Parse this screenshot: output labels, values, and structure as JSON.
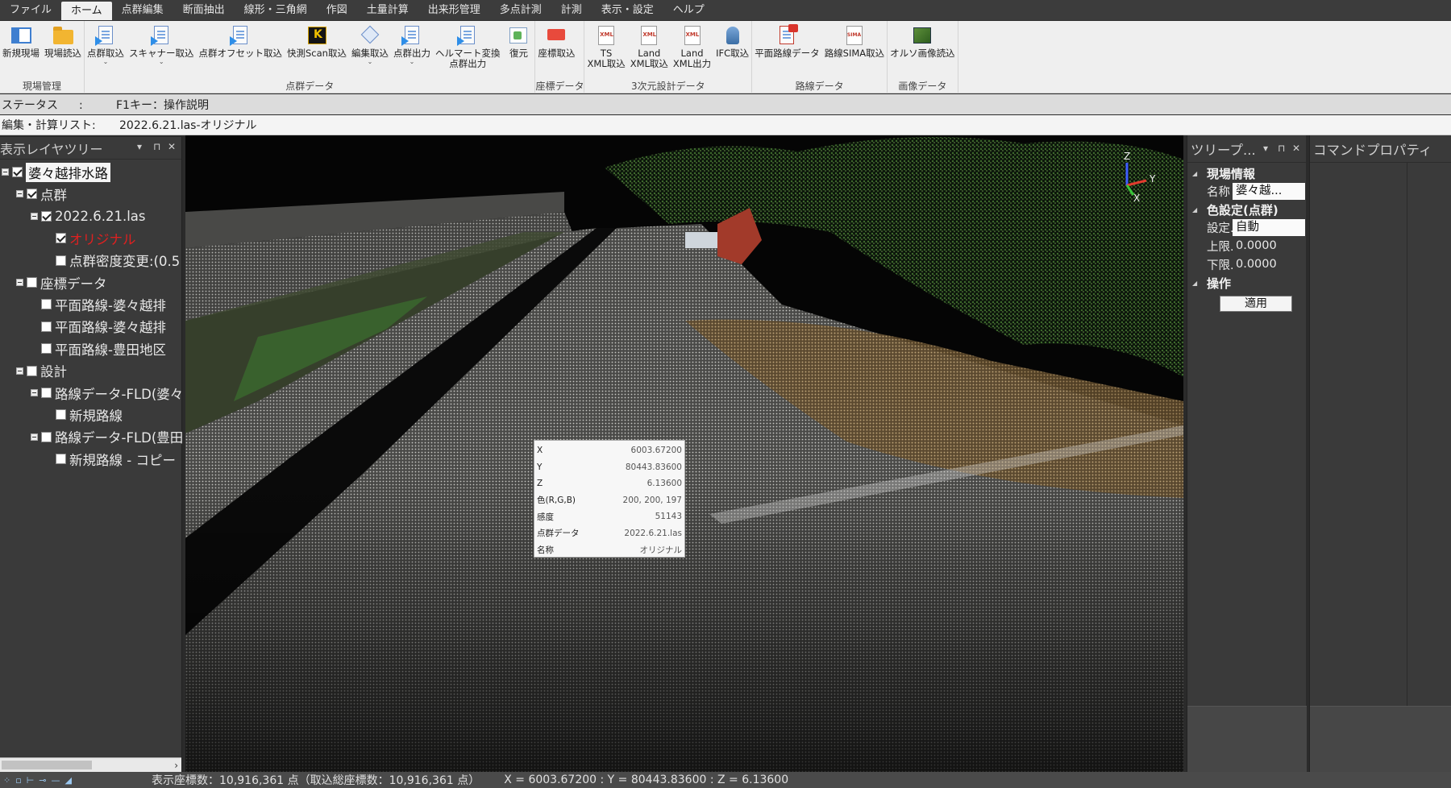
{
  "menu": [
    "ファイル",
    "ホーム",
    "点群編集",
    "断面抽出",
    "線形・三角網",
    "作図",
    "土量計算",
    "出来形管理",
    "多点計測",
    "計測",
    "表示・設定",
    "ヘルプ"
  ],
  "menu_active_index": 1,
  "ribbon": {
    "groups": [
      {
        "label": "現場管理",
        "buttons": [
          {
            "label": "新規現場",
            "icon": "new-site-icon"
          },
          {
            "label": "現場読込",
            "icon": "folder-open-icon"
          }
        ]
      },
      {
        "label": "点群データ",
        "buttons": [
          {
            "label": "点群取込",
            "icon": "pointcloud-import-icon"
          },
          {
            "label": "スキャナー取込",
            "icon": "scanner-import-icon"
          },
          {
            "label": "点群オフセット取込",
            "icon": "offset-import-icon"
          },
          {
            "label": "快測Scan取込",
            "icon": "kaisoku-scan-icon"
          },
          {
            "label": "編集取込",
            "icon": "edit-import-icon"
          },
          {
            "label": "点群出力",
            "icon": "pointcloud-export-icon"
          },
          {
            "label": "ヘルマート変換\n点群出力",
            "icon": "helmert-export-icon"
          },
          {
            "label": "復元",
            "icon": "restore-icon"
          }
        ]
      },
      {
        "label": "座標データ",
        "buttons": [
          {
            "label": "座標取込",
            "icon": "coord-import-icon"
          }
        ]
      },
      {
        "label": "3次元設計データ",
        "buttons": [
          {
            "label": "TS\nXML取込",
            "icon": "ts-xml-icon"
          },
          {
            "label": "Land\nXML取込",
            "icon": "landxml-import-icon"
          },
          {
            "label": "Land\nXML出力",
            "icon": "landxml-export-icon"
          },
          {
            "label": "IFC取込",
            "icon": "ifc-import-icon"
          }
        ]
      },
      {
        "label": "路線データ",
        "buttons": [
          {
            "label": "平面路線データ",
            "icon": "plane-route-icon"
          },
          {
            "label": "路線SIMA取込",
            "icon": "route-sima-icon"
          }
        ]
      },
      {
        "label": "画像データ",
        "buttons": [
          {
            "label": "オルソ画像読込",
            "icon": "ortho-image-icon"
          }
        ]
      }
    ]
  },
  "status": {
    "label": "ステータス",
    "sep": ":",
    "value": "F1キー：操作説明"
  },
  "calc_list": {
    "label": "編集・計算リスト:",
    "value": "2022.6.21.las-オリジナル"
  },
  "layer_tree": {
    "title": "表示レイヤツリー",
    "items": [
      {
        "label": "婆々越排水路",
        "indent": 0,
        "checked": true,
        "expander": true,
        "style": "root"
      },
      {
        "label": "点群",
        "indent": 1,
        "checked": true,
        "expander": true
      },
      {
        "label": "2022.6.21.las",
        "indent": 2,
        "checked": true,
        "expander": true
      },
      {
        "label": "オリジナル",
        "indent": 3,
        "checked": true,
        "expander": false,
        "style": "red"
      },
      {
        "label": "点群密度変更:(0.5",
        "indent": 3,
        "checked": false,
        "expander": false
      },
      {
        "label": "座標データ",
        "indent": 1,
        "checked": false,
        "expander": true
      },
      {
        "label": "平面路線-婆々越排",
        "indent": 2,
        "checked": false,
        "expander": false
      },
      {
        "label": "平面路線-婆々越排",
        "indent": 2,
        "checked": false,
        "expander": false
      },
      {
        "label": "平面路線-豊田地区",
        "indent": 2,
        "checked": false,
        "expander": false
      },
      {
        "label": "設計",
        "indent": 1,
        "checked": false,
        "expander": true
      },
      {
        "label": "路線データ-FLD(婆々",
        "indent": 2,
        "checked": false,
        "expander": true
      },
      {
        "label": "新規路線",
        "indent": 3,
        "checked": false,
        "expander": false
      },
      {
        "label": "路線データ-FLD(豊田",
        "indent": 2,
        "checked": false,
        "expander": true
      },
      {
        "label": "新規路線 - コピー",
        "indent": 3,
        "checked": false,
        "expander": false
      }
    ]
  },
  "point_info": {
    "rows": [
      {
        "k": "X",
        "v": "6003.67200"
      },
      {
        "k": "Y",
        "v": "80443.83600"
      },
      {
        "k": "Z",
        "v": "6.13600"
      },
      {
        "k": "色(R,G,B)",
        "v": "200, 200, 197"
      },
      {
        "k": "感度",
        "v": "51143"
      },
      {
        "k": "点群データ",
        "v": "2022.6.21.las"
      },
      {
        "k": "名称",
        "v": "オリジナル"
      }
    ]
  },
  "axis_labels": {
    "z": "Z",
    "y": "Y",
    "x": "X"
  },
  "tree_panel": {
    "title": "ツリープ...",
    "site_info": "現場情報",
    "name_label": "名称",
    "name_value": "婆々越...",
    "color_setting": "色設定(点群)",
    "setting_label": "設定...",
    "setting_value": "自動",
    "upper_label": "上限...",
    "upper_value": "0.0000",
    "lower_label": "下限...",
    "lower_value": "0.0000",
    "operation": "操作",
    "apply_label": "適用"
  },
  "command_panel": {
    "title": "コマンドプロパティ"
  },
  "bottom": {
    "count": "表示座標数：10,916,361 点（取込総座標数：10,916,361 点）",
    "coords": "X = 6003.67200 : Y = 80443.83600 : Z = 6.13600"
  }
}
